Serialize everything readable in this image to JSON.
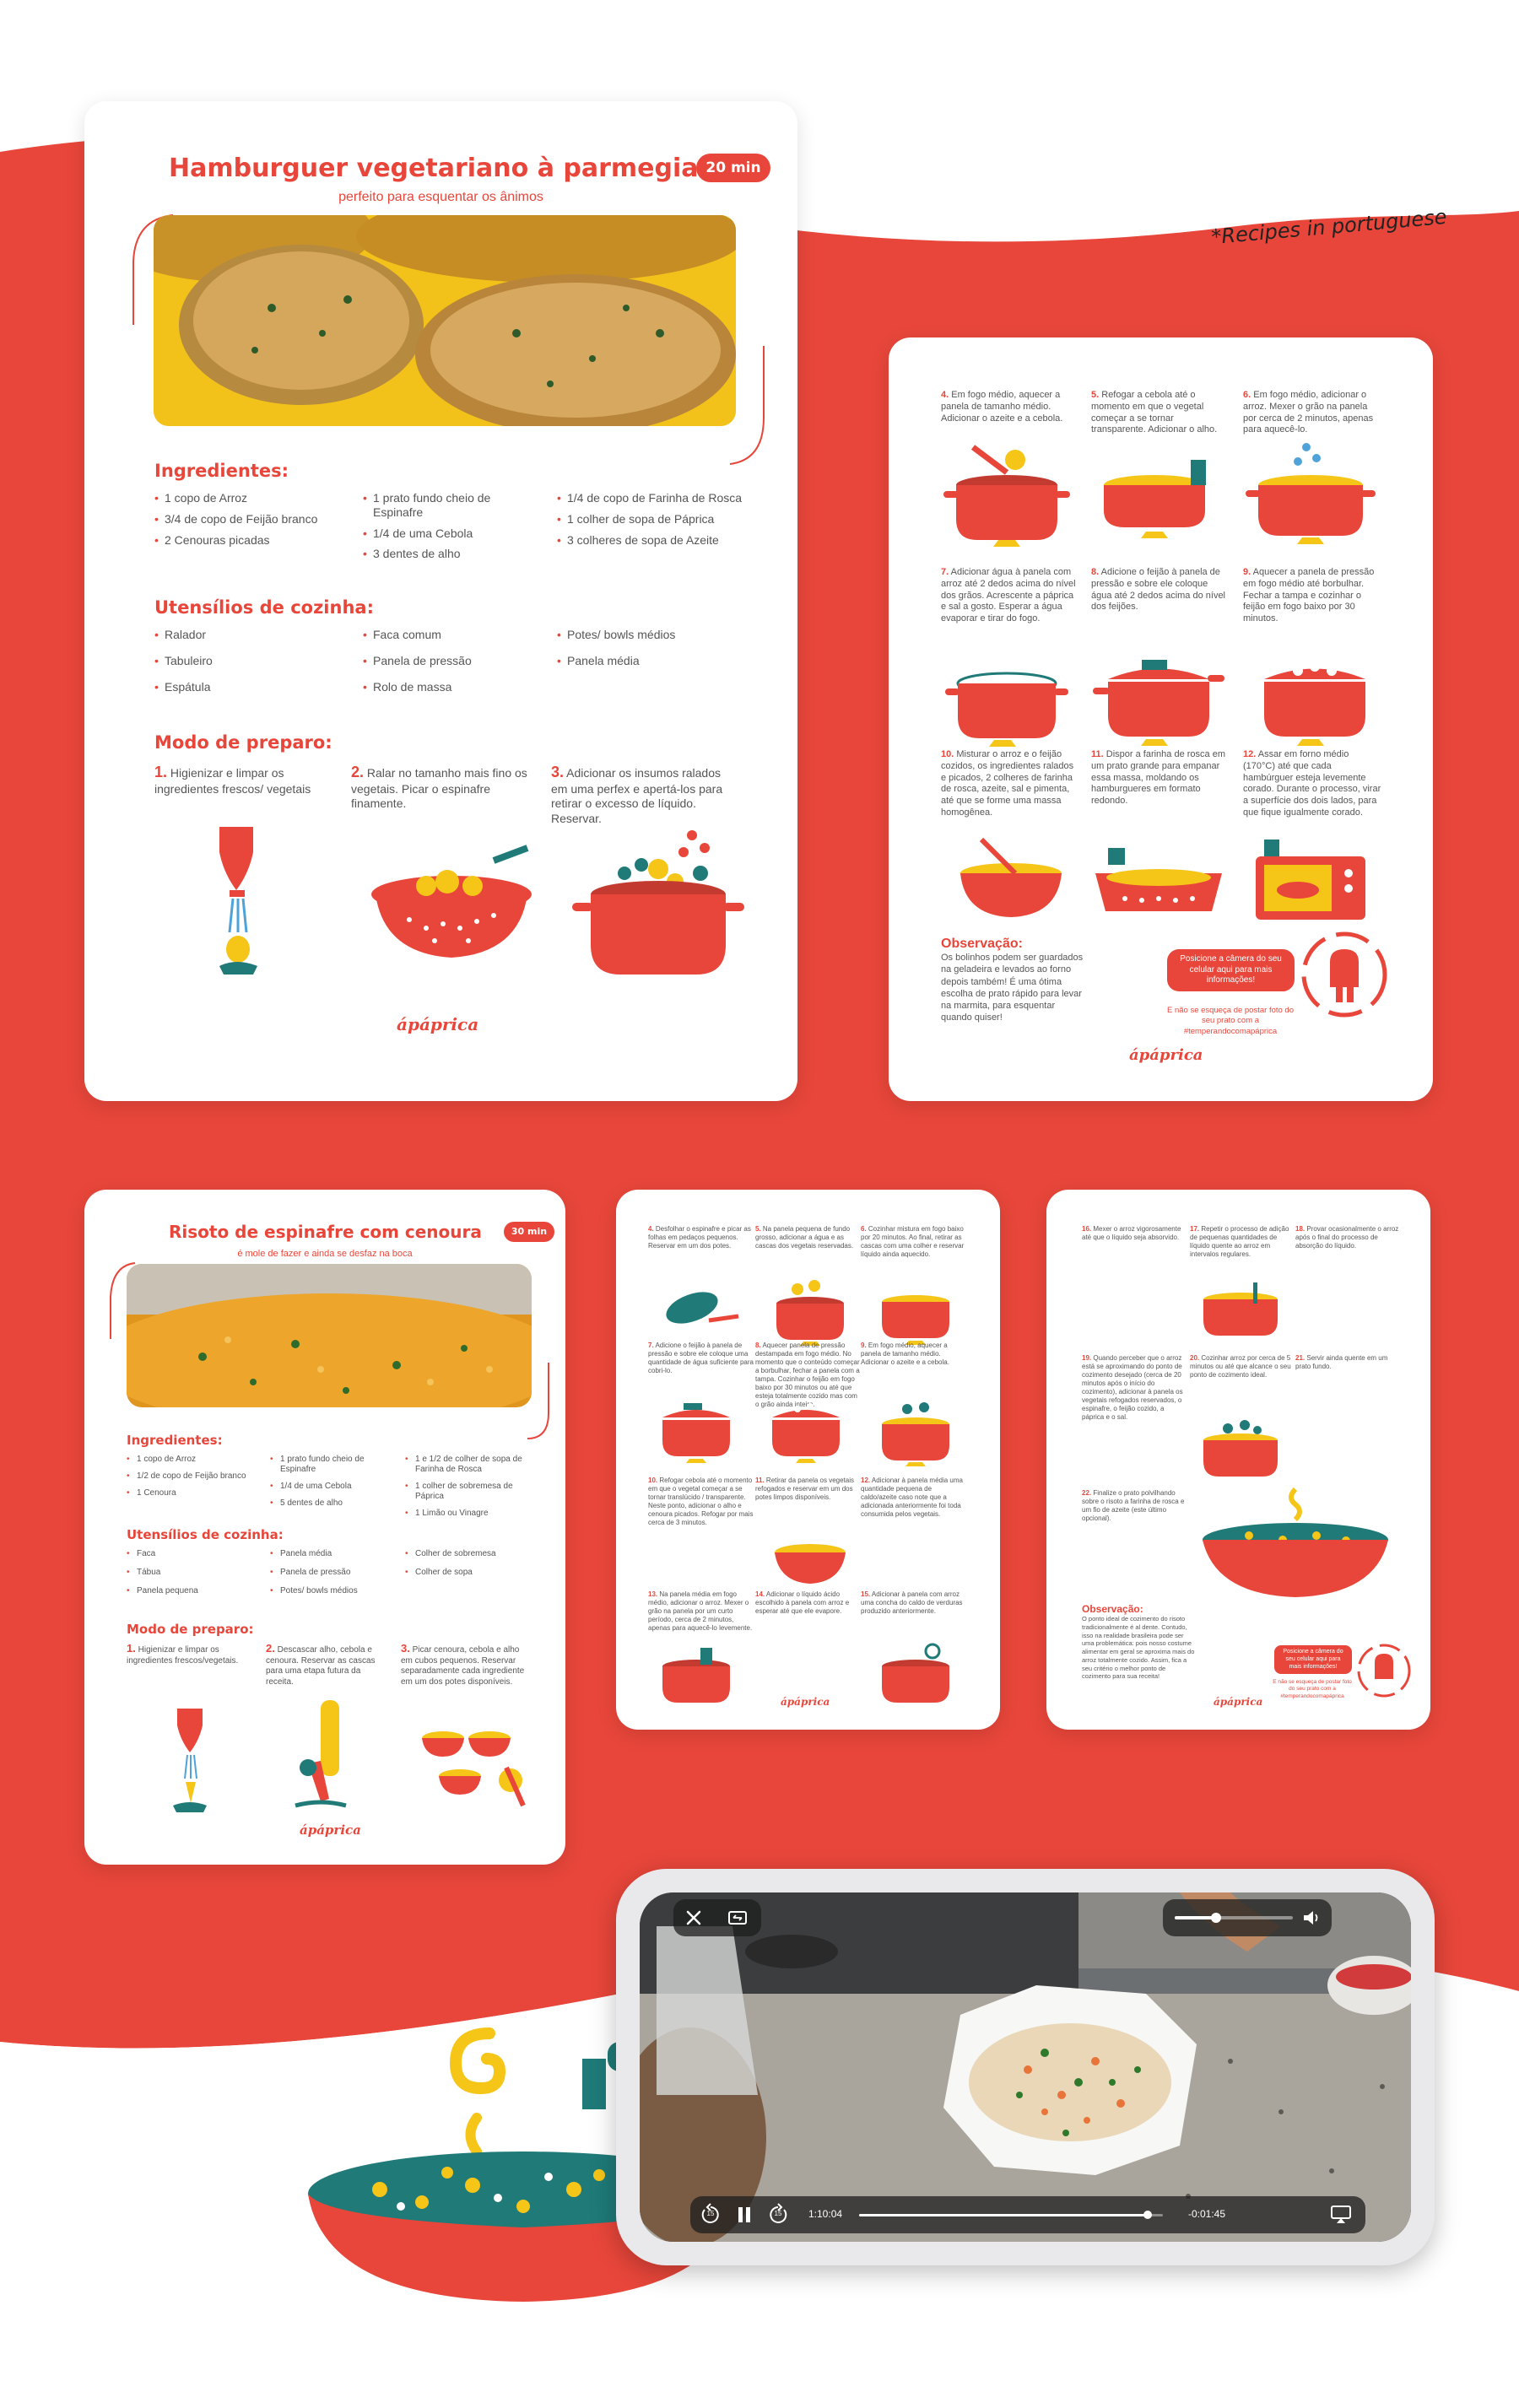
{
  "tagline": "*Recipes in portuguese",
  "colors": {
    "accent": "#e8463a",
    "teal": "#1f7a78",
    "yellow": "#f5c518"
  },
  "card1": {
    "title": "Hamburguer vegetariano à parmegiana",
    "time": "20 min",
    "subtitle": "perfeito para esquentar os ânimos",
    "ingredients_heading": "Ingredientes:",
    "ingredients_col1": [
      "1 copo de Arroz",
      "3/4 de copo de Feijão branco",
      "2 Cenouras picadas"
    ],
    "ingredients_col2": [
      "1 prato fundo cheio de Espinafre",
      "1/4 de uma Cebola",
      "3 dentes de alho"
    ],
    "ingredients_col3": [
      "1/4 de copo de Farinha de Rosca",
      "1 colher de sopa de Páprica",
      "3 colheres de sopa de Azeite"
    ],
    "utensils_heading": "Utensílios de cozinha:",
    "utensils_col1": [
      "Ralador",
      "Tabuleiro",
      "Espátula"
    ],
    "utensils_col2": [
      "Faca comum",
      "Panela de pressão",
      "Rolo de massa"
    ],
    "utensils_col3": [
      "Potes/ bowls médios",
      "Panela média"
    ],
    "method_heading": "Modo de preparo:",
    "steps": [
      {
        "n": "1.",
        "t": "Higienizar e limpar os ingredientes frescos/ vegetais"
      },
      {
        "n": "2.",
        "t": "Ralar no tamanho mais fino os vegetais. Picar o espinafre finamente."
      },
      {
        "n": "3.",
        "t": "Adicionar os insumos ralados em uma perfex e apertá-los para retirar o excesso de líquido. Reservar."
      }
    ],
    "logo": "ápáprica"
  },
  "card2": {
    "steps": [
      {
        "n": "4.",
        "t": "Em fogo médio, aquecer a panela de tamanho médio. Adicionar o azeite e a cebola."
      },
      {
        "n": "5.",
        "t": "Refogar a cebola até o momento em que o vegetal começar a se tornar transparente. Adicionar o alho."
      },
      {
        "n": "6.",
        "t": "Em fogo médio, adicionar o arroz. Mexer o grão na panela por cerca de 2 minutos, apenas para aquecê-lo."
      },
      {
        "n": "7.",
        "t": "Adicionar água à panela com arroz até 2 dedos acima do nível dos grãos. Acrescente a páprica e sal a gosto. Esperar a água evaporar e tirar do fogo."
      },
      {
        "n": "8.",
        "t": "Adicione o feijão à panela de pressão e sobre ele coloque água até 2 dedos acima do nível dos feijões."
      },
      {
        "n": "9.",
        "t": "Aquecer a panela de pressão em fogo médio até borbulhar. Fechar a tampa e cozinhar o feijão em fogo baixo por 30 minutos."
      },
      {
        "n": "10.",
        "t": "Misturar o arroz e o feijão cozidos, os ingredientes ralados e picados, 2 colheres de farinha de rosca, azeite, sal e pimenta, até que se forme uma massa homogênea."
      },
      {
        "n": "11.",
        "t": "Dispor a farinha de rosca em um prato grande para empanar essa massa, moldando os hamburgueres em formato redondo."
      },
      {
        "n": "12.",
        "t": "Assar em forno médio (170°C) até que cada hambúrguer esteja levemente corado. Durante o processo, virar a superfície dos dois lados, para que fique igualmente corado."
      }
    ],
    "note_heading": "Observação:",
    "note_text": "Os bolinhos podem ser guardados na geladeira e levados ao forno depois também! É uma ótima escolha de prato rápido para levar na marmita, para esquentar quando quiser!",
    "bubble": "Posicione a câmera do seu celular aqui para mais informações!",
    "bubble_sub": "E não se esqueça de postar foto do seu prato com a #temperandocomapáprica",
    "logo": "ápáprica"
  },
  "card3": {
    "title": "Risoto de espinafre com cenoura",
    "time": "30 min",
    "subtitle": "é mole de fazer e ainda se desfaz na boca",
    "ingredients_heading": "Ingredientes:",
    "ingredients_col1": [
      "1 copo de Arroz",
      "1/2 de copo de Feijão branco",
      "1 Cenoura"
    ],
    "ingredients_col2": [
      "1 prato fundo cheio de Espinafre",
      "1/4 de uma Cebola",
      "5 dentes de alho"
    ],
    "ingredients_col3": [
      "1 e 1/2 de colher de sopa de Farinha de Rosca",
      "1 colher de sobremesa de Páprica",
      "1 Limão ou Vinagre"
    ],
    "utensils_heading": "Utensílios de cozinha:",
    "utensils_col1": [
      "Faca",
      "Tábua",
      "Panela pequena"
    ],
    "utensils_col2": [
      "Panela média",
      "Panela de pressão",
      "Potes/ bowls médios"
    ],
    "utensils_col3": [
      "Colher de sobremesa",
      "Colher de sopa"
    ],
    "method_heading": "Modo de preparo:",
    "steps": [
      {
        "n": "1.",
        "t": "Higienizar e limpar os ingredientes frescos/vegetais."
      },
      {
        "n": "2.",
        "t": "Descascar alho, cebola e cenoura. Reservar as cascas para uma etapa futura da receita."
      },
      {
        "n": "3.",
        "t": "Picar cenoura, cebola e alho em cubos pequenos. Reservar separadamente cada ingrediente em um dos potes disponíveis."
      }
    ],
    "logo": "ápáprica"
  },
  "card4": {
    "steps": [
      {
        "n": "4.",
        "t": "Desfolhar o espinafre e picar as folhas em pedaços pequenos. Reservar em um dos potes."
      },
      {
        "n": "5.",
        "t": "Na panela pequena de fundo grosso, adicionar a água e as cascas dos vegetais reservadas."
      },
      {
        "n": "6.",
        "t": "Cozinhar mistura em fogo baixo por 20 minutos. Ao final, retirar as cascas com uma colher e reservar líquido ainda aquecido."
      },
      {
        "n": "7.",
        "t": "Adicione o feijão à panela de pressão e sobre ele coloque uma quantidade de água suficiente para cobri-lo."
      },
      {
        "n": "8.",
        "t": "Aquecer panela de pressão destampada em fogo médio. No momento que o conteúdo começar a borbulhar, fechar a panela com a tampa. Cozinhar o feijão em fogo baixo por 30 minutos ou até que esteja totalmente cozido mas com o grão ainda inteiro."
      },
      {
        "n": "9.",
        "t": "Em fogo médio, aquecer a panela de tamanho médio. Adicionar o azeite e a cebola."
      },
      {
        "n": "10.",
        "t": "Refogar cebola até o momento em que o vegetal começar a se tornar translúcido / transparente. Neste ponto, adicionar o alho e cenoura picados. Refogar por mais cerca de 3 minutos."
      },
      {
        "n": "11.",
        "t": "Retirar da panela os vegetais refogados e reservar em um dos potes limpos disponíveis."
      },
      {
        "n": "12.",
        "t": "Adicionar à panela média uma quantidade pequena de caldo/azeite caso note que a adicionada anteriormente foi toda consumida pelos vegetais."
      },
      {
        "n": "13.",
        "t": "Na panela média em fogo médio, adicionar o arroz. Mexer o grão na panela por um curto período, cerca de 2 minutos, apenas para aquecê-lo levemente."
      },
      {
        "n": "14.",
        "t": "Adicionar o líquido ácido escolhido à panela com arroz e esperar até que ele evapore."
      },
      {
        "n": "15.",
        "t": "Adicionar à panela com arroz uma concha do caldo de verduras produzido anteriormente."
      }
    ],
    "logo": "ápáprica"
  },
  "card5": {
    "steps": [
      {
        "n": "16.",
        "t": "Mexer o arroz vigorosamente até que o líquido seja absorvido."
      },
      {
        "n": "17.",
        "t": "Repetir o processo de adição de pequenas quantidades de líquido quente ao arroz em intervalos regulares."
      },
      {
        "n": "18.",
        "t": "Provar ocasionalmente o arroz após o final do processo de absorção do líquido."
      },
      {
        "n": "19.",
        "t": "Quando perceber que o arroz está se aproximando do ponto de cozimento desejado (cerca de 20 minutos após o início do cozimento), adicionar à panela os vegetais refogados reservados, o espinafre, o feijão cozido, a páprica e o sal."
      },
      {
        "n": "20.",
        "t": "Cozinhar arroz por cerca de 5 minutos ou até que alcance o seu ponto de cozimento ideal."
      },
      {
        "n": "21.",
        "t": "Servir ainda quente em um prato fundo."
      },
      {
        "n": "22.",
        "t": "Finalize o prato polvilhando sobre o risoto a farinha de rosca e um fio de azeite (este último opcional)."
      }
    ],
    "note_heading": "Observação:",
    "note_text": "O ponto ideal de cozimento do risoto tradicionalmente é al dente. Contudo, isso na realidade brasileira pode ser uma problemática: pois nosso costume alimentar em geral se aproxima mais do arroz totalmente cozido. Assim, fica a seu critério o melhor ponto de cozimento para sua receita!",
    "bubble": "Posicione a câmera do seu celular aqui para mais informações!",
    "bubble_sub": "E não se esqueça de postar foto do seu prato com a #temperandocomapáprica",
    "logo": "ápáprica"
  },
  "video": {
    "elapsed": "1:10:04",
    "remaining": "-0:01:45",
    "progress": 0.95,
    "volume": 0.35,
    "icons": [
      "close-icon",
      "resize-icon",
      "volume-icon",
      "rewind-15-icon",
      "pause-icon",
      "forward-15-icon",
      "airplay-icon"
    ],
    "skip_label": "15"
  }
}
